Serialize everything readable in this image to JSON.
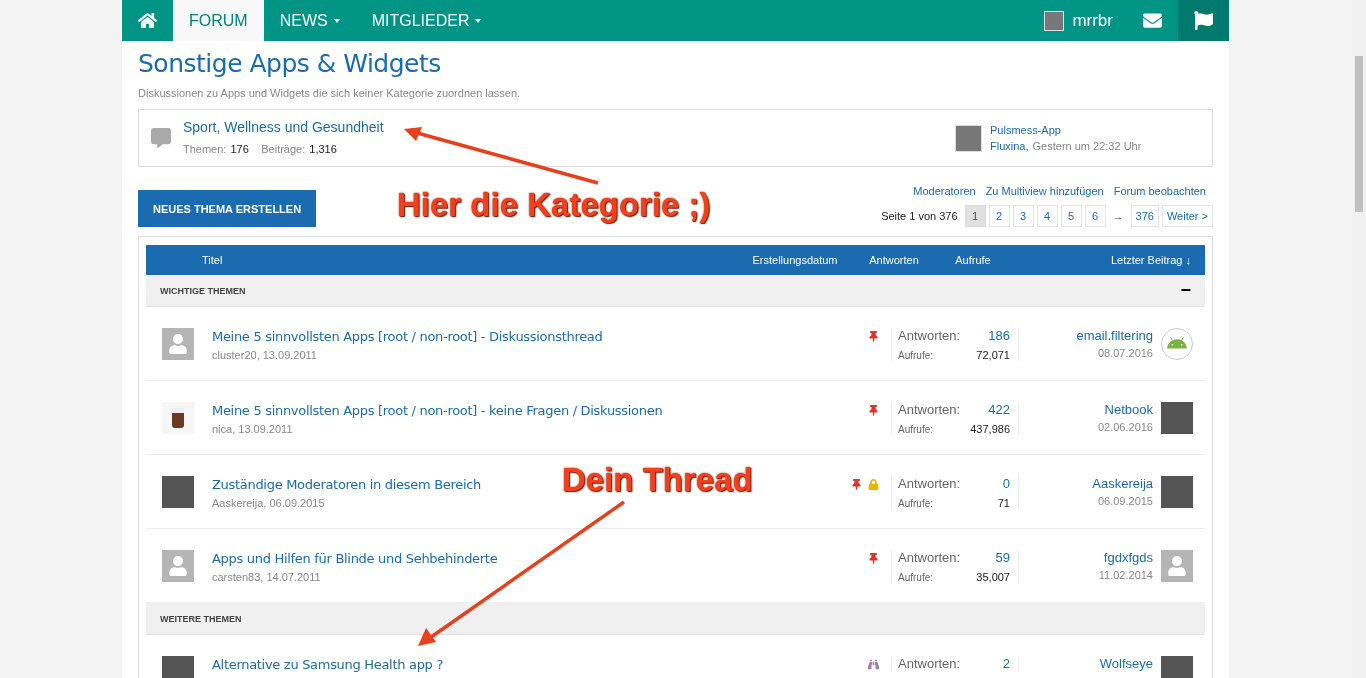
{
  "nav": {
    "tabs": [
      {
        "label": "FORUM",
        "selected": true,
        "caret": false
      },
      {
        "label": "NEWS",
        "selected": false,
        "caret": true
      },
      {
        "label": "MITGLIEDER",
        "selected": false,
        "caret": true
      }
    ],
    "user": "mrrbr"
  },
  "page": {
    "title": "Sonstige Apps & Widgets",
    "description": "Diskussionen zu Apps und Widgets die sich keiner Kategorie zuordnen lassen."
  },
  "category": {
    "title": "Sport, Wellness und Gesundheit",
    "themen_label": "Themen:",
    "themen": "176",
    "beitraege_label": "Beiträge:",
    "beitraege": "1,316",
    "last_thread": "Pulsmess-App",
    "last_user": "Fluxina,",
    "last_time": "Gestern um 22:32 Uhr"
  },
  "new_thread_button": "NEUES THEMA ERSTELLEN",
  "links": [
    "Moderatoren",
    "Zu Multiview hinzufügen",
    "Forum beobachten"
  ],
  "pagination": {
    "label": "Seite 1 von 376",
    "pages": [
      {
        "label": "1",
        "selected": true
      },
      {
        "label": "2",
        "selected": false
      },
      {
        "label": "3",
        "selected": false
      },
      {
        "label": "4",
        "selected": false
      },
      {
        "label": "5",
        "selected": false
      },
      {
        "label": "6",
        "selected": false
      }
    ],
    "gap": "→",
    "last": "376",
    "next": "Weiter >"
  },
  "table": {
    "columns": [
      "Titel",
      "Erstellungsdatum",
      "Antworten",
      "Aufrufe",
      "Letzter Beitrag ↓"
    ],
    "groups": [
      {
        "label": "WICHTIGE THEMEN",
        "collapse": "−",
        "threads": [
          {
            "title": "Meine 5 sinnvollsten Apps [root / non-root] - Diskussionsthread",
            "meta": "cluster20, 13.09.2011",
            "icons": [
              {
                "kind": "pin"
              }
            ],
            "replies_label": "Antworten:",
            "replies": "186",
            "views_label": "Aufrufe:",
            "views": "72,071",
            "last_user": "email.filtering",
            "last_date": "08.07.2016",
            "avatar": {
              "kind": "silhouette"
            },
            "last_avatar": {
              "kind": "robot"
            }
          },
          {
            "title": "Meine 5 sinnvollsten Apps [root / non-root] - keine Fragen / Diskussionen",
            "meta": "nica, 13.09.2011",
            "icons": [
              {
                "kind": "pin"
              }
            ],
            "replies_label": "Antworten:",
            "replies": "422",
            "views_label": "Aufrufe:",
            "views": "437,986",
            "last_user": "Netbook",
            "last_date": "02.06.2016",
            "avatar": {
              "kind": "cup"
            },
            "last_avatar": {
              "kind": "photo"
            }
          },
          {
            "title": "Zuständige Moderatoren in diesem Bereich",
            "meta": "Aaskereija, 06.09.2015",
            "icons": [
              {
                "kind": "pin"
              },
              {
                "kind": "lock"
              }
            ],
            "replies_label": "Antworten:",
            "replies": "0",
            "views_label": "Aufrufe:",
            "views": "71",
            "last_user": "Aaskereija",
            "last_date": "06.09.2015",
            "avatar": {
              "kind": "photo"
            },
            "last_avatar": {
              "kind": "photo"
            }
          },
          {
            "title": "Apps und Hilfen für Blinde und Sehbehinderte",
            "meta": "carsten83, 14.07.2011",
            "icons": [
              {
                "kind": "pin"
              }
            ],
            "replies_label": "Antworten:",
            "replies": "59",
            "views_label": "Aufrufe:",
            "views": "35,007",
            "last_user": "fgdxfgds",
            "last_date": "11.02.2014",
            "avatar": {
              "kind": "silhouette"
            },
            "last_avatar": {
              "kind": "silhouette"
            }
          }
        ]
      },
      {
        "label": "WEITERE THEMEN",
        "threads": [
          {
            "title": "Alternative zu Samsung Health app ?",
            "icons": [
              {
                "kind": "watch"
              }
            ],
            "replies_label": "Antworten:",
            "replies": "2",
            "last_user": "Wolfseye",
            "avatar": {
              "kind": "photo"
            },
            "last_avatar": {
              "kind": "photo"
            }
          }
        ]
      }
    ]
  },
  "annotations": [
    {
      "text": "Hier die Kategorie ;)"
    },
    {
      "text": "Dein Thread"
    }
  ]
}
